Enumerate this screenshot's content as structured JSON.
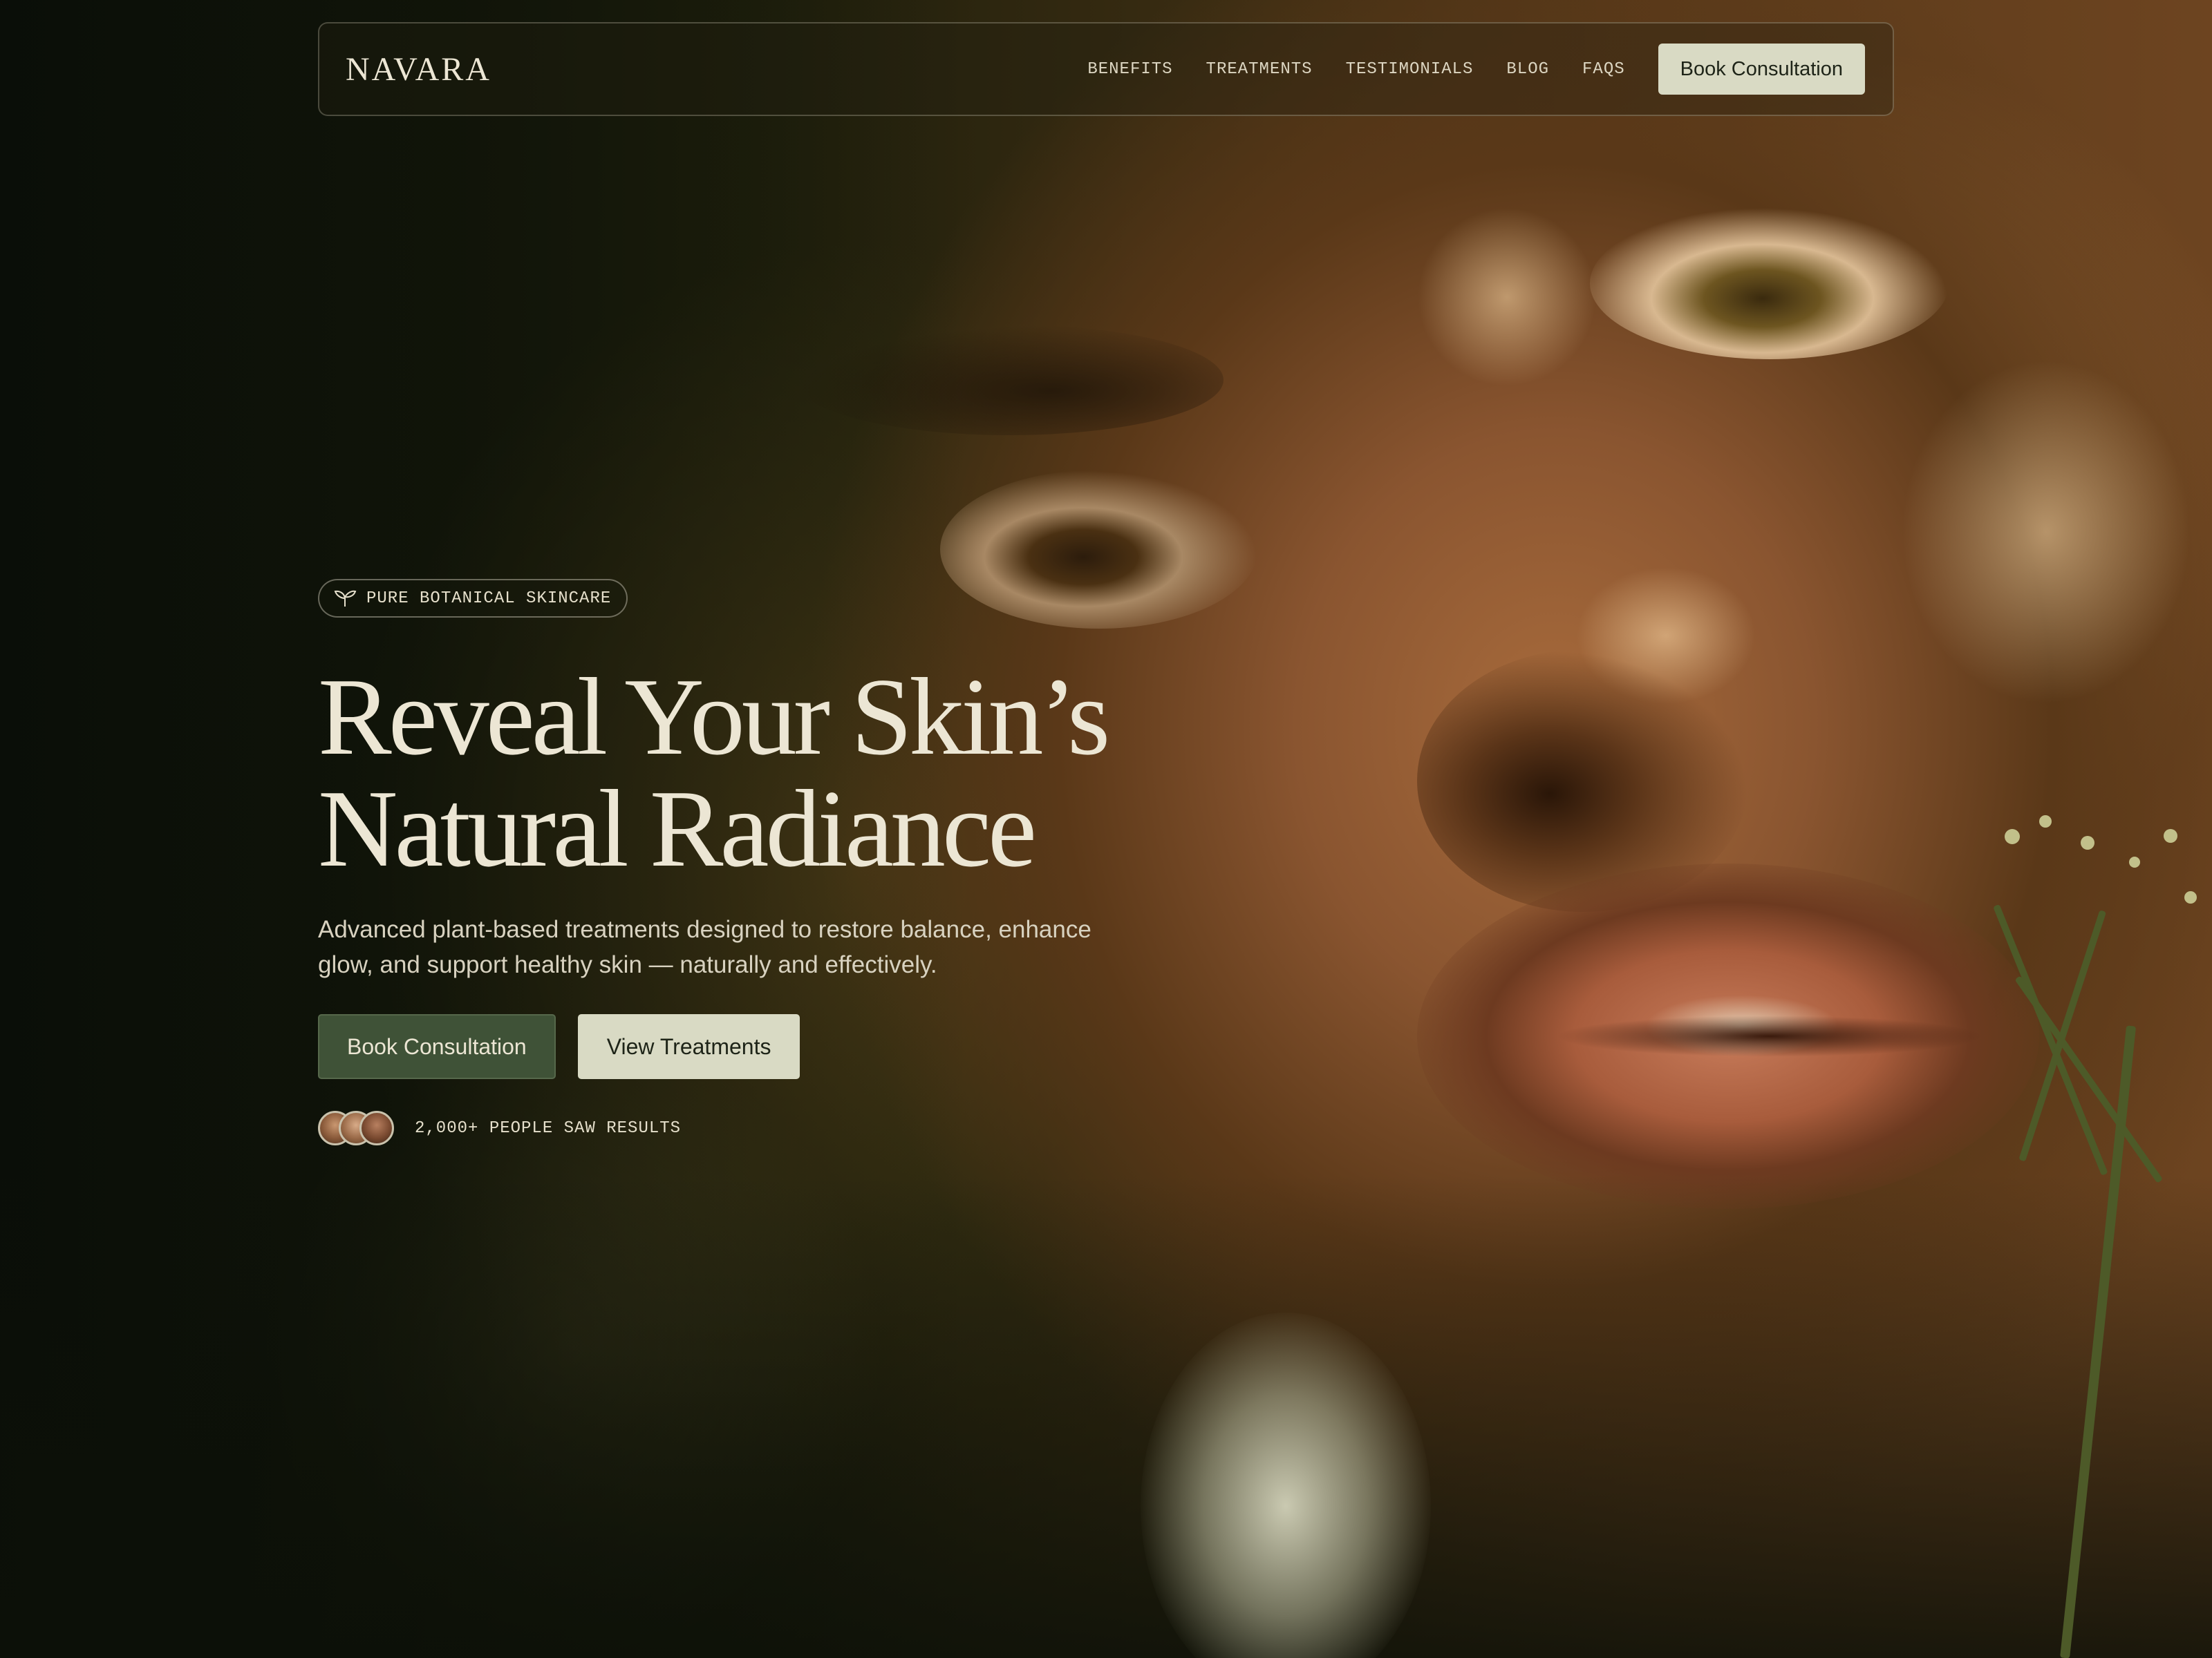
{
  "nav": {
    "brand": "NAVARA",
    "links": [
      "BENEFITS",
      "TREATMENTS",
      "TESTIMONIALS",
      "BLOG",
      "FAQS"
    ],
    "cta": "Book Consultation"
  },
  "hero": {
    "tag": "PURE BOTANICAL SKINCARE",
    "tag_icon": "sprout-icon",
    "headline_line1": "Reveal Your Skin’s",
    "headline_line2": "Natural Radiance",
    "subtext": "Advanced plant-based treatments designed to restore balance, enhance glow, and support healthy skin — naturally and effectively.",
    "primary_cta": "Book Consultation",
    "secondary_cta": "View Treatments",
    "social_proof": "2,000+ PEOPLE SAW RESULTS"
  },
  "colors": {
    "background": "#0f130a",
    "text": "#ece6d4",
    "primary_button": "#3f5237",
    "secondary_button": "#d9dac4"
  }
}
